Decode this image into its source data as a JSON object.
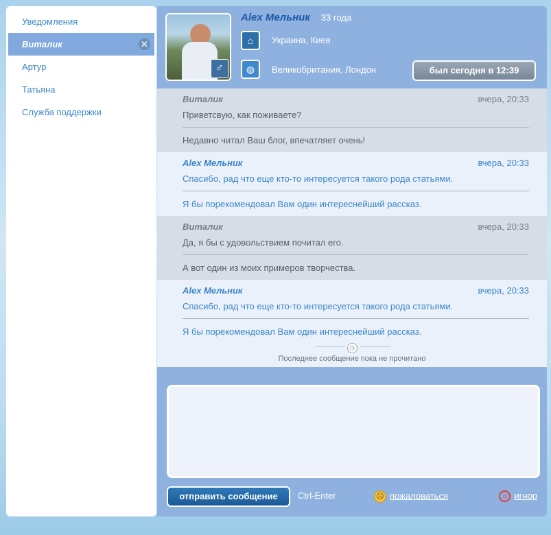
{
  "sidebar": {
    "items": [
      {
        "label": "Уведомления",
        "active": false
      },
      {
        "label": "Виталик",
        "active": true
      },
      {
        "label": "Артур",
        "active": false
      },
      {
        "label": "Татьяна",
        "active": false
      },
      {
        "label": "Служба поддержки",
        "active": false
      }
    ]
  },
  "profile": {
    "name": "Alex  Мельник",
    "age": "33 года",
    "home_location": "Украина, Киев",
    "current_location": "Великобритания, Лондон",
    "last_seen": "был сегодня в 12:39"
  },
  "messages": [
    {
      "author": "Виталик",
      "time": "вчера, 20:33",
      "direction": "in",
      "lines": [
        "Приветсвую, как поживаете?",
        "Недавно читал Ваш блог, впечатляет очень!"
      ]
    },
    {
      "author": "Alex Мельник",
      "time": "вчера, 20:33",
      "direction": "out",
      "lines": [
        "Спасибо, рад что еще кто-то интересуется такого рода статьями.",
        "Я бы порекомендовал Вам один интереснейший рассказ."
      ]
    },
    {
      "author": "Виталик",
      "time": "вчера, 20:33",
      "direction": "in",
      "lines": [
        "Да, я бы с удовольствием почитал его.",
        "А вот один из моих примеров творчества."
      ]
    },
    {
      "author": "Alex Мельник",
      "time": "вчера, 20:33",
      "direction": "out",
      "lines": [
        "Спасибо, рад что еще кто-то интересуется такого рода статьями.",
        "Я бы порекомендовал Вам один интереснейший рассказ."
      ]
    }
  ],
  "unread_notice": "Последнее сообщение пока не прочитано",
  "composer": {
    "text": "",
    "send_label": "отправить сообщение",
    "hotkey": "Ctrl-Enter",
    "complain_label": "пожаловаться",
    "ignore_label": "игнор"
  },
  "colors": {
    "accent": "#3a86c8",
    "header_bg": "#8fb1df",
    "active_item_bg": "#80a9dd",
    "incoming_bg": "#d6dde5",
    "outgoing_bg": "#eaf1fb",
    "send_button": "#1c5a97"
  }
}
